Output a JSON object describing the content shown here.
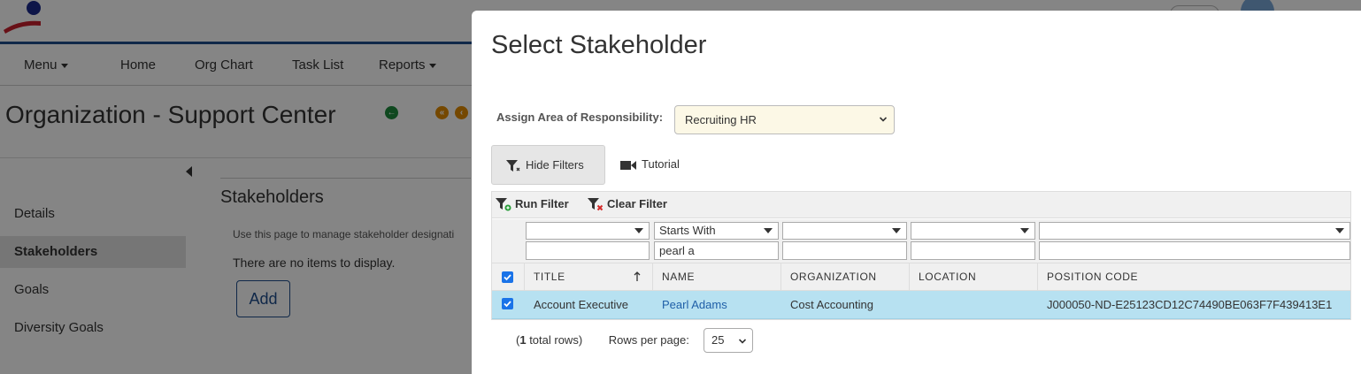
{
  "background": {
    "nav": {
      "menu": "Menu",
      "home": "Home",
      "org_chart": "Org Chart",
      "task_list": "Task List",
      "reports": "Reports"
    },
    "page_title": "Organization - Support Center",
    "sidebar": {
      "items": [
        {
          "label": "Details"
        },
        {
          "label": "Stakeholders"
        },
        {
          "label": "Goals"
        },
        {
          "label": "Diversity Goals"
        }
      ]
    },
    "section_title": "Stakeholders",
    "help_text": "Use this page to manage stakeholder designati",
    "empty_text": "There are no items to display.",
    "add_label": "Add"
  },
  "dialog": {
    "title": "Select Stakeholder",
    "assign_label": "Assign Area of Responsibility:",
    "assign_value": "Recruiting HR",
    "hide_filters": "Hide Filters",
    "tutorial": "Tutorial",
    "run_filter": "Run Filter",
    "clear_filter": "Clear Filter",
    "filters": {
      "title_op": "",
      "name_op": "Starts With",
      "org_op": "",
      "loc_op": "",
      "pos_op": "",
      "title_val": "",
      "name_val": "pearl a",
      "org_val": "",
      "loc_val": "",
      "pos_val": ""
    },
    "columns": [
      "TITLE",
      "NAME",
      "ORGANIZATION",
      "LOCATION",
      "POSITION CODE"
    ],
    "rows": [
      {
        "title": "Account Executive",
        "name": "Pearl Adams",
        "organization": "Cost Accounting",
        "location": "",
        "position_code": "J000050-ND-E25123CD12C74490BE063F7F439413E1"
      }
    ],
    "total_count": "1",
    "total_suffix": " total rows)",
    "rows_per_page_label": "Rows per page:",
    "rows_per_page": "25"
  },
  "colors": {
    "accent": "#1f4e8c",
    "selected_row": "#b7e1f1",
    "assign_field": "#fcf8e6",
    "link": "#1f5fa8"
  }
}
